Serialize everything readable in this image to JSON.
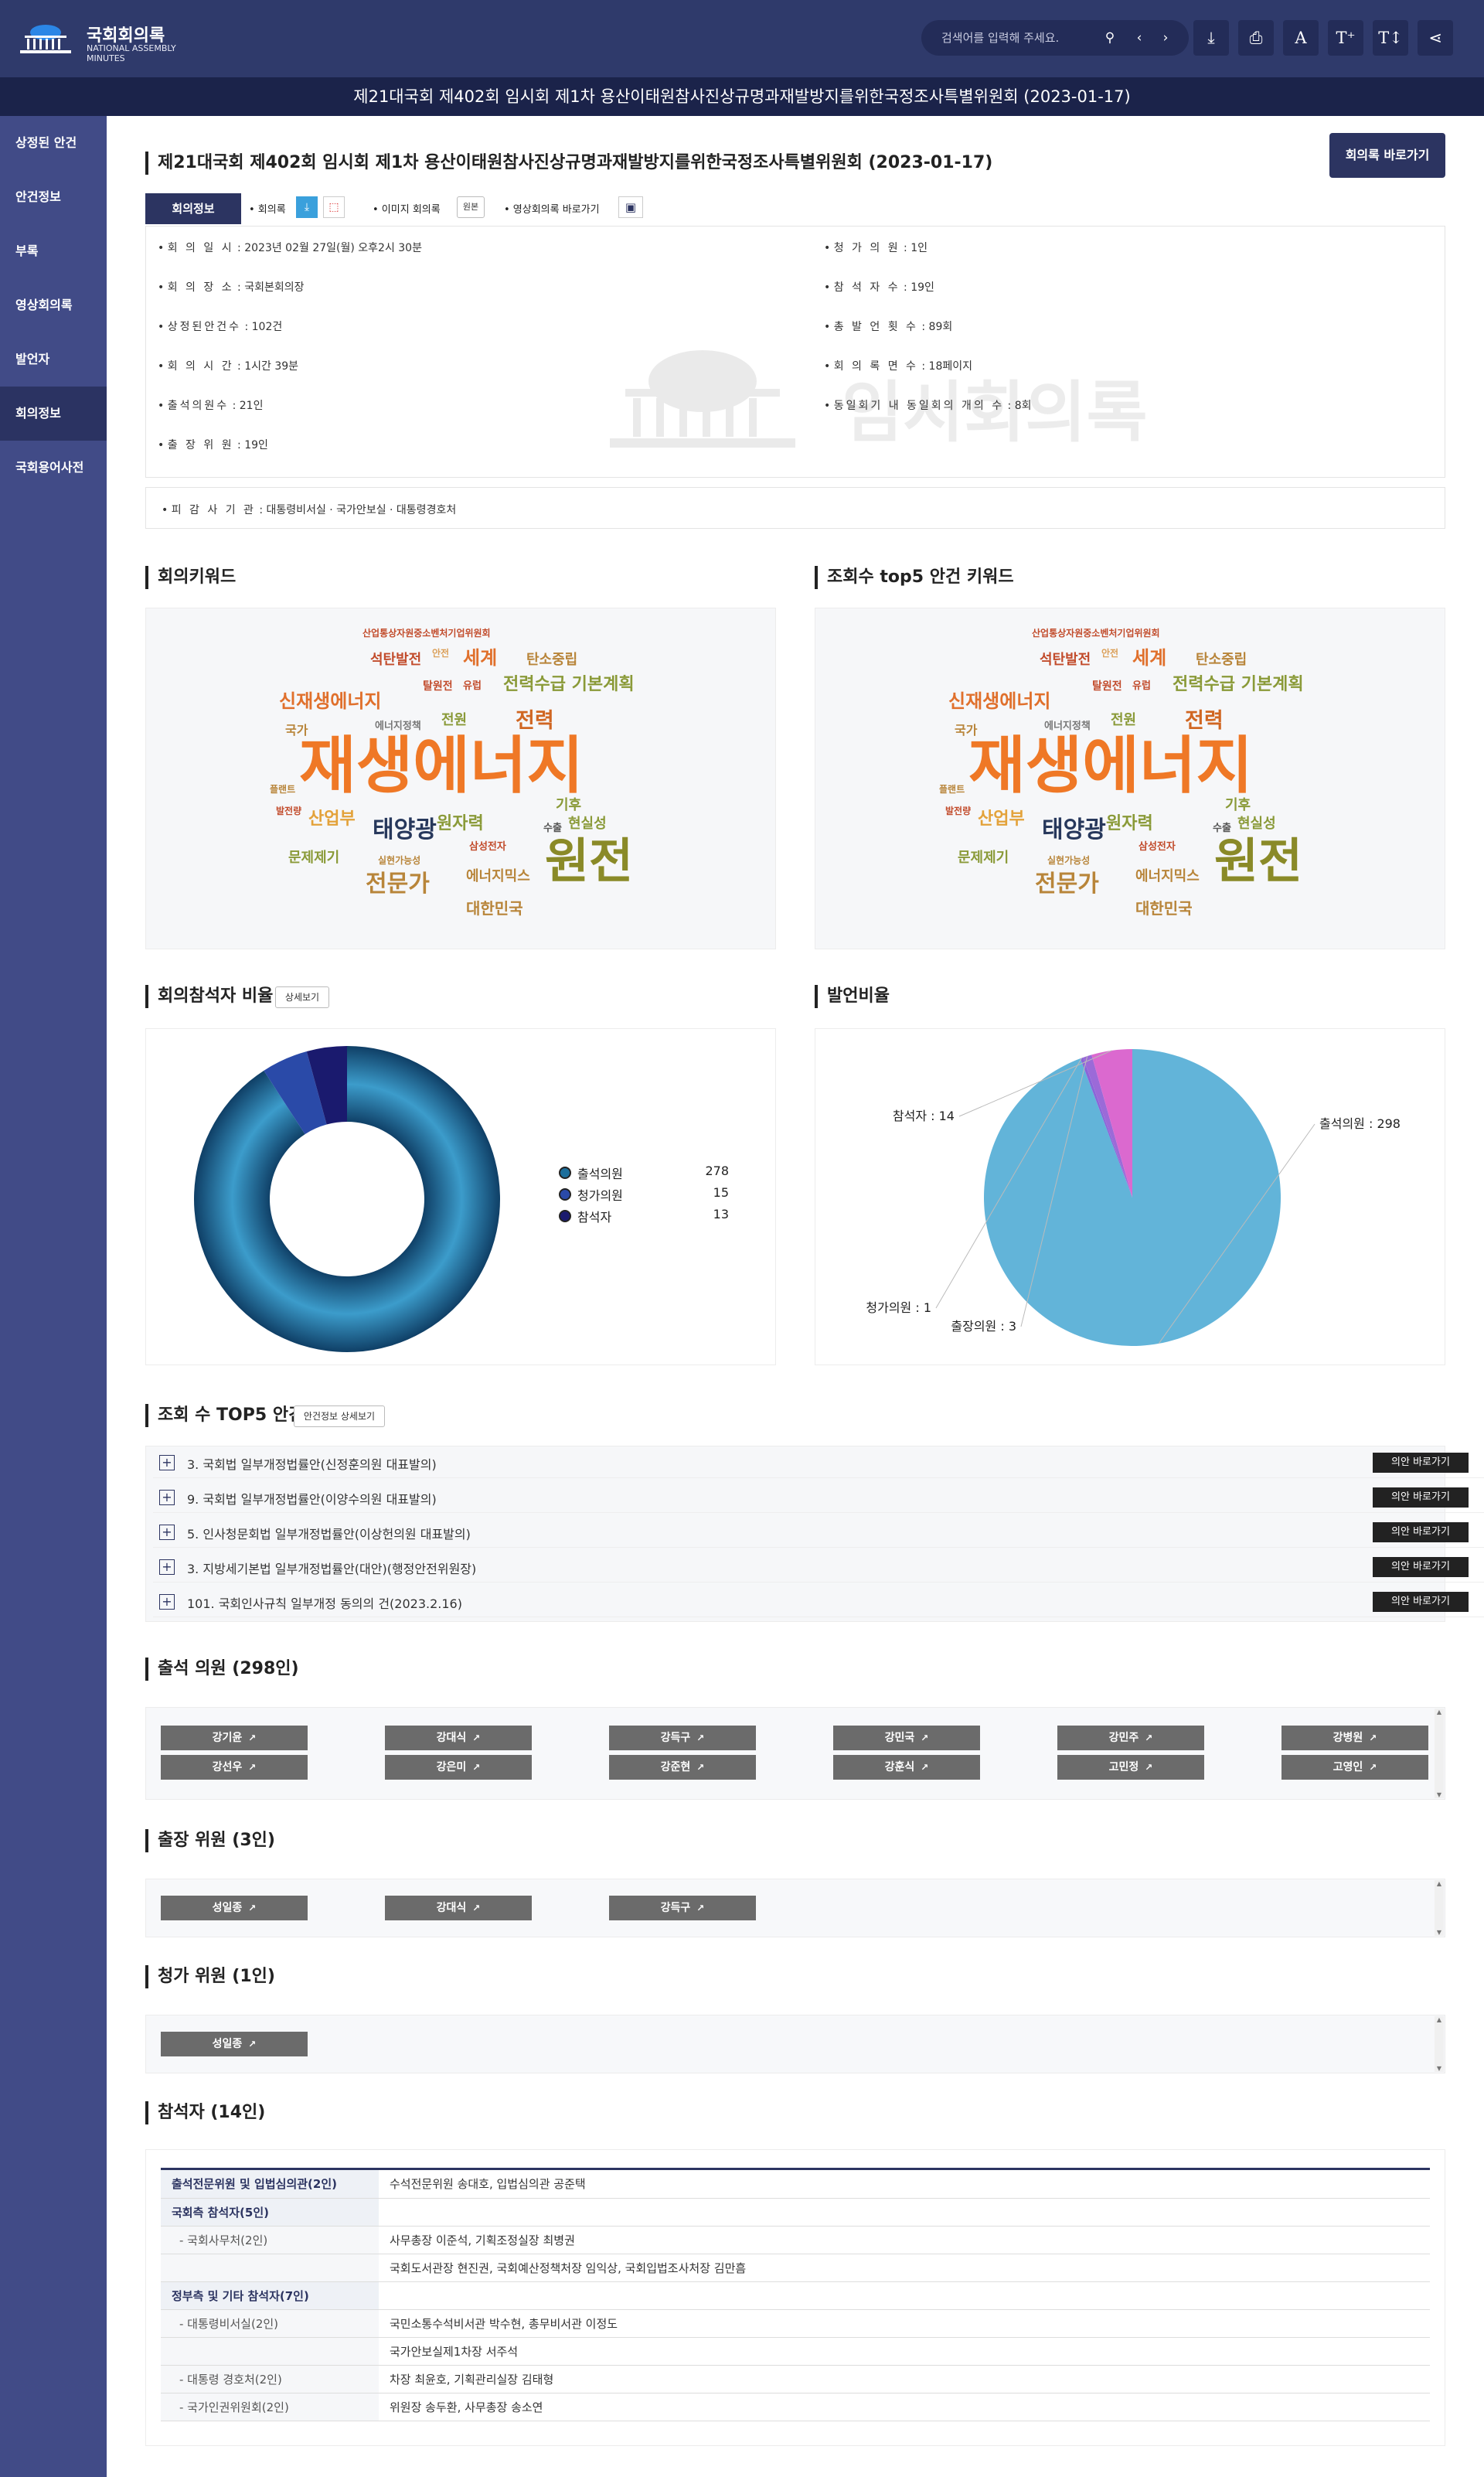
{
  "header": {
    "logo_title": "국회회의록",
    "logo_subtitle": "NATIONAL ASSEMBLY MINUTES",
    "search_placeholder": "검색어를 입력해 주세요.",
    "font_a": "A",
    "font_plus": "T⁺",
    "font_minus": "T↕"
  },
  "titlebar": "제21대국회 제402회 임시회 제1차 용산이태원참사진상규명과재발방지를위한국정조사특별위원회 (2023-01-17)",
  "sidebar": [
    "상정된 안건",
    "안건정보",
    "부록",
    "영상회의록",
    "발언자",
    "회의정보",
    "국회용어사전"
  ],
  "meeting": {
    "title": "제21대국회 제402회 임시회 제1차 용산이태원참사진상규명과재발방지를위한국정조사특별위원회 (2023-01-17)",
    "shortcut_btn": "회의록 바로가기",
    "tab": "회의정보",
    "links": {
      "minutes": "• 회의록",
      "image_minutes": "• 이미지 회의록",
      "original": "원본",
      "video": "• 영상회의록 바로가기"
    },
    "left": [
      {
        "k": "회 의 일 시",
        "v": "2023년 02월 27일(월) 오후2시 30분"
      },
      {
        "k": "회 의 장 소",
        "v": "국회본회의장"
      },
      {
        "k": "상정된안건수",
        "v": "102건"
      },
      {
        "k": "회 의 시 간",
        "v": "1시간 39분"
      },
      {
        "k": "출석의원수",
        "v": "21인"
      },
      {
        "k": "출 장 위 원",
        "v": "19인"
      }
    ],
    "right": [
      {
        "k": "청 가 의 원",
        "v": "1인"
      },
      {
        "k": "참 석 자 수",
        "v": "19인"
      },
      {
        "k": "총 발 언 횟 수",
        "v": "89회"
      },
      {
        "k": "회 의 록 면 수",
        "v": "18페이지"
      },
      {
        "k": "동일회기 내 동일회의 개의 수",
        "v": "8회"
      }
    ],
    "watermark": "임시회의록",
    "inspected": {
      "k": "피 감 사 기 관",
      "v": "대통령비서실 · 국가안보실 · 대통령경호처"
    }
  },
  "keywords": {
    "title1": "회의키워드",
    "title2": "조회수 top5 안건 키워드",
    "words": [
      "산업통상자원중소벤처기업위원회",
      "석탄발전",
      "안전",
      "세계",
      "탄소중립",
      "탈원전",
      "유럽",
      "전력수급 기본계획",
      "신재생에너지",
      "에너지정책",
      "전원",
      "전력",
      "국가",
      "재생에너지",
      "플랜트",
      "발전량",
      "기후",
      "산업부",
      "태양광",
      "원자력",
      "수출",
      "현실성",
      "문제제기",
      "실현가능성",
      "삼성전자",
      "원전",
      "에너지믹스",
      "전문가",
      "대한민국"
    ]
  },
  "attend_chart": {
    "title": "회의참석자 비율",
    "detail_btn": "상세보기",
    "type": "pie",
    "categories": [
      "출석의원",
      "청가의원",
      "참석자"
    ],
    "values": [
      278,
      15,
      13
    ],
    "colors": [
      "#1d6f9c",
      "#2a4aa8",
      "#1a1a6e"
    ]
  },
  "speech_chart": {
    "title": "발언비율",
    "type": "pie",
    "categories": [
      "출석의원",
      "청가의원",
      "출장의원",
      "참석자"
    ],
    "values": [
      298,
      1,
      3,
      14
    ],
    "labels": [
      "출석의원 : 298",
      "청가의원 : 1",
      "출장의원 : 3",
      "참석자 : 14"
    ],
    "colors": [
      "#62b4d9",
      "#8a65d8",
      "#9b6ad8",
      "#db69cf"
    ]
  },
  "top5": {
    "title": "조회 수 TOP5 안건",
    "detail_btn": "안건정보 상세보기",
    "go_label": "의안 바로가기",
    "items": [
      "3. 국회법 일부개정법률안(신정훈의원 대표발의)",
      "9. 국회법 일부개정법률안(이양수의원 대표발의)",
      "5. 인사청문회법 일부개정법률안(이상헌의원 대표발의)",
      "3. 지방세기본법 일부개정법률안(대안)(행정안전위원장)",
      "101. 국회인사규칙 일부개정 동의의 건(2023.2.16)"
    ]
  },
  "attending": {
    "title": "출석 의원 (298인)",
    "members": [
      "강기윤",
      "강대식",
      "강득구",
      "강민국",
      "강민주",
      "강병원",
      "강선우",
      "강은미",
      "강준현",
      "강훈식",
      "고민정",
      "고영인"
    ]
  },
  "trip": {
    "title": "출장 위원 (3인)",
    "members": [
      "성일종",
      "강대식",
      "강득구"
    ]
  },
  "leave": {
    "title": "청가 위원 (1인)",
    "members": [
      "성일종"
    ]
  },
  "participants": {
    "title": "참석자 (14인)",
    "rows": [
      {
        "c1": "출석전문위원 및 입법심의관(2인)",
        "type": "grp",
        "c2": "수석전문위원 송대호, 입법심의관 공준택"
      },
      {
        "c1": "국회측 참석자(5인)",
        "type": "grp",
        "c2": ""
      },
      {
        "c1": "- 국회사무처(2인)",
        "type": "sub",
        "c2": "사무총장 이준석, 기획조정실장 최병권"
      },
      {
        "c1": "",
        "type": "sub",
        "c2": "국회도서관장 현진권, 국회예산정책처장 임익상, 국회입법조사처장 김만흠"
      },
      {
        "c1": "정부측 및 기타 참석자(7인)",
        "type": "grp",
        "c2": ""
      },
      {
        "c1": "- 대통령비서실(2인)",
        "type": "sub",
        "c2": "국민소통수석비서관 박수현, 총무비서관 이정도"
      },
      {
        "c1": "",
        "type": "sub",
        "c2": "국가안보실제1차장 서주석"
      },
      {
        "c1": "- 대통령 경호처(2인)",
        "type": "sub",
        "c2": "차장 최윤호, 기획관리실장 김태형"
      },
      {
        "c1": "- 국가인권위원회(2인)",
        "type": "sub",
        "c2": "위원장 송두환, 사무총장 송소연"
      }
    ]
  }
}
